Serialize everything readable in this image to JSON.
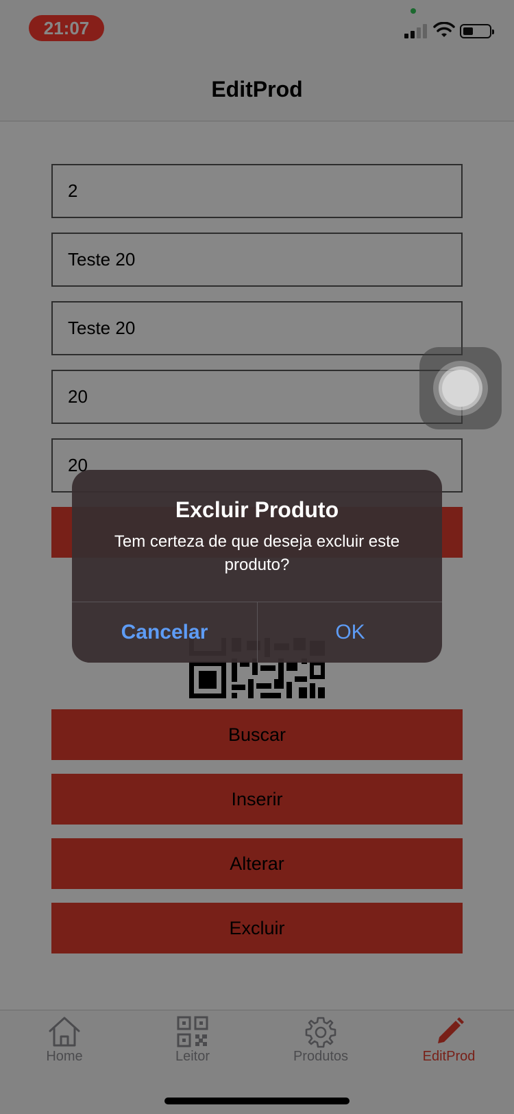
{
  "status_bar": {
    "time": "21:07"
  },
  "header": {
    "title": "EditProd"
  },
  "form": {
    "fields": [
      {
        "value": "2"
      },
      {
        "value": "Teste 20"
      },
      {
        "value": "Teste 20"
      },
      {
        "value": "20"
      },
      {
        "value": "20"
      }
    ]
  },
  "buttons": {
    "search": "Buscar",
    "insert": "Inserir",
    "update": "Alterar",
    "delete": "Excluir"
  },
  "tabs": [
    {
      "label": "Home",
      "icon": "home-icon",
      "active": false
    },
    {
      "label": "Leitor",
      "icon": "qr-code-icon",
      "active": false
    },
    {
      "label": "Produtos",
      "icon": "gear-icon",
      "active": false
    },
    {
      "label": "EditProd",
      "icon": "pencil-icon",
      "active": true
    }
  ],
  "alert": {
    "title": "Excluir Produto",
    "message": "Tem certeza de que deseja excluir este produto?",
    "cancel_label": "Cancelar",
    "ok_label": "OK"
  },
  "colors": {
    "accent": "#e23d2f",
    "alert_button": "#5e9cf5",
    "tab_inactive": "#8e8e93"
  }
}
